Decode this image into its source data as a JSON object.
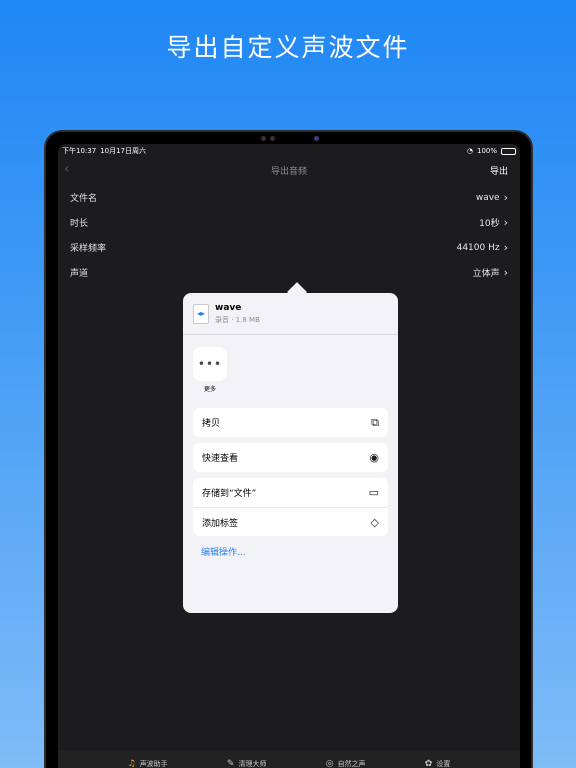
{
  "headline": "导出自定义声波文件",
  "status": {
    "time": "下午10:37",
    "date": "10月17日周六",
    "battery": "100%"
  },
  "nav": {
    "back": "‹",
    "title": "导出音频",
    "action": "导出"
  },
  "rows": [
    {
      "label": "文件名",
      "value": "wave"
    },
    {
      "label": "时长",
      "value": "10秒"
    },
    {
      "label": "采样频率",
      "value": "44100 Hz"
    },
    {
      "label": "声道",
      "value": "立体声"
    }
  ],
  "share": {
    "file_name": "wave",
    "file_sub": "录音 · 1.8 MB",
    "more_label": "更多",
    "actions": {
      "copy": "拷贝",
      "quicklook": "快速查看",
      "save_files": "存储到“文件”",
      "add_tags": "添加标签"
    },
    "edit_actions": "编辑操作..."
  },
  "tabs": [
    {
      "label": "声波助手",
      "icon": "headphones-icon"
    },
    {
      "label": "清理大师",
      "icon": "broom-icon"
    },
    {
      "label": "自然之声",
      "icon": "music-icon"
    },
    {
      "label": "设置",
      "icon": "gear-icon"
    }
  ],
  "colors": {
    "accent": "#2f80ed",
    "active_tab": "#f3a712",
    "bg_top": "#1f87f5",
    "bg_bottom": "#7fbcf8"
  }
}
